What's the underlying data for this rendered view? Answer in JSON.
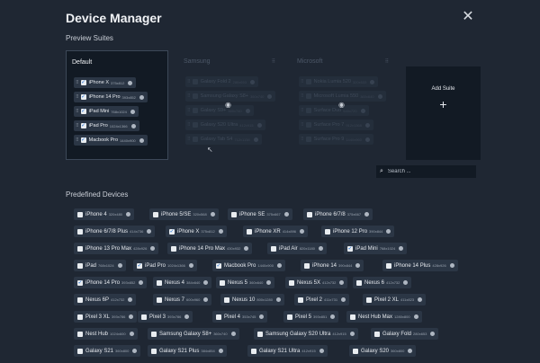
{
  "title": "Device Manager",
  "preview_suites_label": "Preview Suites",
  "suites": [
    {
      "name": "Default",
      "menu": "",
      "active": true,
      "devices": [
        {
          "label": "iPhone X",
          "dim": "375x812",
          "checked": true
        },
        {
          "label": "iPhone 14 Pro",
          "dim": "393x852",
          "checked": true
        },
        {
          "label": "iPad Mini",
          "dim": "768x1024",
          "checked": true
        },
        {
          "label": "iPad Pro",
          "dim": "1024x1366",
          "checked": true
        },
        {
          "label": "Macbook Pro",
          "dim": "1440x900",
          "checked": true
        }
      ]
    },
    {
      "name": "Samsung",
      "menu": "⠿",
      "active": false,
      "devices": [
        {
          "label": "Galaxy Fold 2",
          "dim": "280x653",
          "checked": false
        },
        {
          "label": "Samsung Galaxy S8+",
          "dim": "360x740",
          "checked": false
        },
        {
          "label": "Galaxy S9+",
          "dim": "360x740",
          "checked": false
        },
        {
          "label": "Galaxy S20 Ultra",
          "dim": "412x915",
          "checked": false
        },
        {
          "label": "Galaxy Tab S4",
          "dim": "712x1138",
          "checked": false
        }
      ]
    },
    {
      "name": "Microsoft",
      "menu": "⠿",
      "active": false,
      "devices": [
        {
          "label": "Nokia Lumia 520",
          "dim": "320x533",
          "checked": false
        },
        {
          "label": "Microsoft Lumia 550",
          "dim": "360x640",
          "checked": false
        },
        {
          "label": "Surface Duo",
          "dim": "540x720",
          "checked": false
        },
        {
          "label": "Surface Pro 7",
          "dim": "912x1368",
          "checked": false
        },
        {
          "label": "Surface Pro 9",
          "dim": "1440x960",
          "checked": false
        }
      ]
    }
  ],
  "add_suite_label": "Add Suite",
  "search": {
    "placeholder": "Search ..."
  },
  "predefined_label": "Predefined Devices",
  "devices": [
    {
      "label": "iPhone 4",
      "dim": "320x480",
      "checked": false
    },
    {
      "label": "iPhone 5/SE",
      "dim": "320x568",
      "checked": false
    },
    {
      "label": "iPhone SE",
      "dim": "375x667",
      "checked": false
    },
    {
      "label": "iPhone 6/7/8",
      "dim": "375x667",
      "checked": false
    },
    {
      "label": "iPhone 6/7/8 Plus",
      "dim": "414x736",
      "checked": false
    },
    {
      "label": "iPhone X",
      "dim": "375x812",
      "checked": true
    },
    {
      "label": "iPhone XR",
      "dim": "414x896",
      "checked": false
    },
    {
      "label": "iPhone 12 Pro",
      "dim": "390x844",
      "checked": false
    },
    {
      "label": "iPhone 13 Pro Max",
      "dim": "428x926",
      "checked": false
    },
    {
      "label": "iPhone 14 Pro Max",
      "dim": "430x932",
      "checked": false
    },
    {
      "label": "iPad Air",
      "dim": "820x1180",
      "checked": false
    },
    {
      "label": "iPad Mini",
      "dim": "768x1024",
      "checked": true
    },
    {
      "label": "iPad",
      "dim": "768x1024",
      "checked": false
    },
    {
      "label": "iPad Pro",
      "dim": "1024x1366",
      "checked": true
    },
    {
      "label": "Macbook Pro",
      "dim": "1440x900",
      "checked": true
    },
    {
      "label": "iPhone 14",
      "dim": "390x844",
      "checked": false
    },
    {
      "label": "iPhone 14 Plus",
      "dim": "428x926",
      "checked": false
    },
    {
      "label": "iPhone 14 Pro",
      "dim": "393x852",
      "checked": true
    },
    {
      "label": "Nexus 4",
      "dim": "384x640",
      "checked": false
    },
    {
      "label": "Nexus 5",
      "dim": "360x640",
      "checked": false
    },
    {
      "label": "Nexus 5X",
      "dim": "412x732",
      "checked": false
    },
    {
      "label": "Nexus 6",
      "dim": "412x732",
      "checked": false
    },
    {
      "label": "Nexus 6P",
      "dim": "412x732",
      "checked": false
    },
    {
      "label": "Nexus 7",
      "dim": "600x960",
      "checked": false
    },
    {
      "label": "Nexus 10",
      "dim": "800x1280",
      "checked": false
    },
    {
      "label": "Pixel 2",
      "dim": "411x731",
      "checked": false
    },
    {
      "label": "Pixel 2 XL",
      "dim": "411x823",
      "checked": false
    },
    {
      "label": "Pixel 3 XL",
      "dim": "393x786",
      "checked": false
    },
    {
      "label": "Pixel 3",
      "dim": "393x786",
      "checked": false
    },
    {
      "label": "Pixel 4",
      "dim": "353x745",
      "checked": false
    },
    {
      "label": "Pixel 5",
      "dim": "393x851",
      "checked": false
    },
    {
      "label": "Nest Hub Max",
      "dim": "1280x800",
      "checked": false
    },
    {
      "label": "Nest Hub",
      "dim": "1024x600",
      "checked": false
    },
    {
      "label": "Samsung Galaxy S8+",
      "dim": "360x740",
      "checked": false
    },
    {
      "label": "Samsung Galaxy S20 Ultra",
      "dim": "412x915",
      "checked": false
    },
    {
      "label": "Galaxy Fold",
      "dim": "280x653",
      "checked": false
    },
    {
      "label": "Galaxy S21",
      "dim": "360x800",
      "checked": false
    },
    {
      "label": "Galaxy S21 Plus",
      "dim": "384x854",
      "checked": false
    },
    {
      "label": "Galaxy S21 Ultra",
      "dim": "412x915",
      "checked": false
    },
    {
      "label": "Galaxy S20",
      "dim": "360x800",
      "checked": false
    }
  ],
  "icons": {
    "close": "close-icon",
    "search": "search-icon",
    "eye": "eye-icon",
    "add": "plus-icon",
    "grip": "drag-handle-icon",
    "info": "info-icon"
  },
  "colors": {
    "background": "#1f2733",
    "panel": "#121a24",
    "chip": "#2b3645",
    "check": "#1f6fd6"
  }
}
